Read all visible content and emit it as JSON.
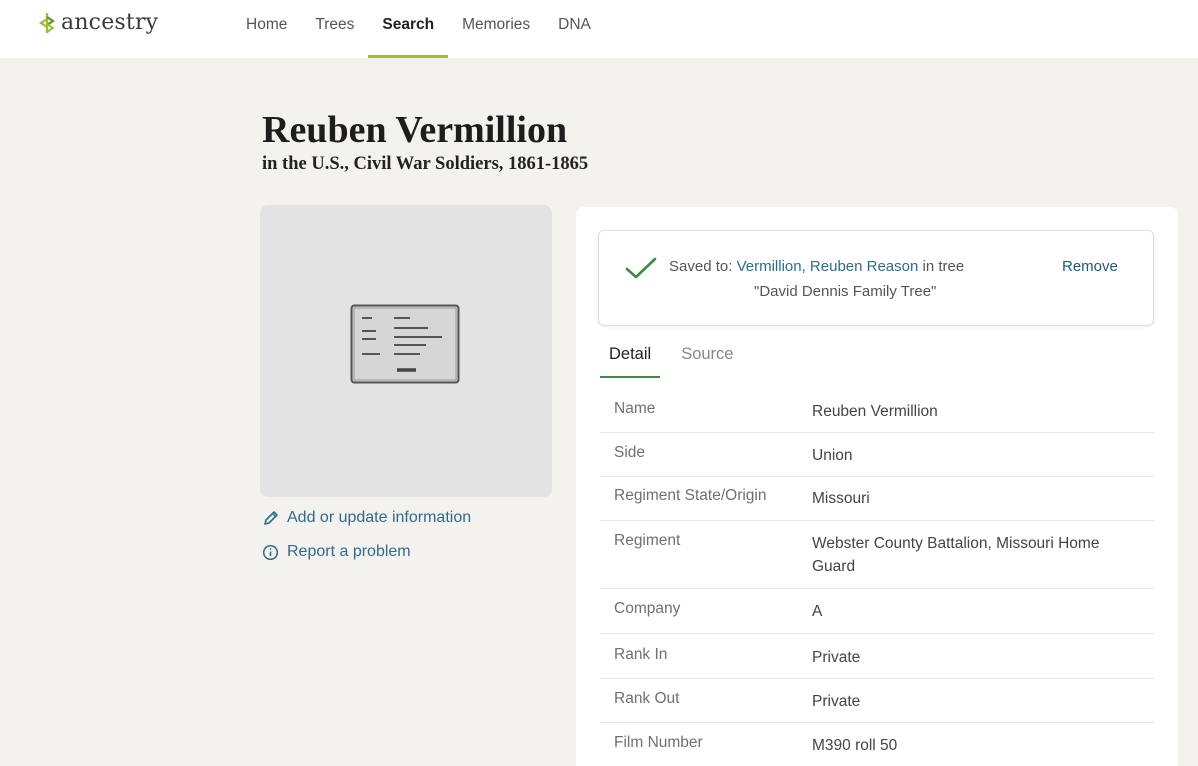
{
  "header": {
    "logo_text": "ancestry",
    "nav": [
      "Home",
      "Trees",
      "Search",
      "Memories",
      "DNA"
    ],
    "active_nav": "Search"
  },
  "record": {
    "name": "Reuben Vermillion",
    "collection": "in the U.S., Civil War Soldiers, 1861-1865"
  },
  "sidebar": {
    "add_update": "Add or update information",
    "report": "Report a problem"
  },
  "saved": {
    "prefix": "Saved to:",
    "person_link": "Vermillion, Reuben Reason",
    "in_tree": "in tree",
    "tree_name": "\"David Dennis Family Tree\"",
    "remove": "Remove"
  },
  "tabs": [
    "Detail",
    "Source"
  ],
  "active_tab": "Detail",
  "details": [
    {
      "label": "Name",
      "value": "Reuben Vermillion"
    },
    {
      "label": "Side",
      "value": "Union"
    },
    {
      "label": "Regiment State/Origin",
      "value": "Missouri"
    },
    {
      "label": "Regiment",
      "value": "Webster County Battalion, Missouri Home Guard"
    },
    {
      "label": "Company",
      "value": "A"
    },
    {
      "label": "Rank In",
      "value": "Private"
    },
    {
      "label": "Rank Out",
      "value": "Private"
    },
    {
      "label": "Film Number",
      "value": "M390 roll 50"
    }
  ],
  "colors": {
    "accent_green": "#9cbe3c",
    "tab_underline": "#3b8c3c",
    "link_blue": "#2f6c8a",
    "page_bg": "#f4f2ef"
  }
}
